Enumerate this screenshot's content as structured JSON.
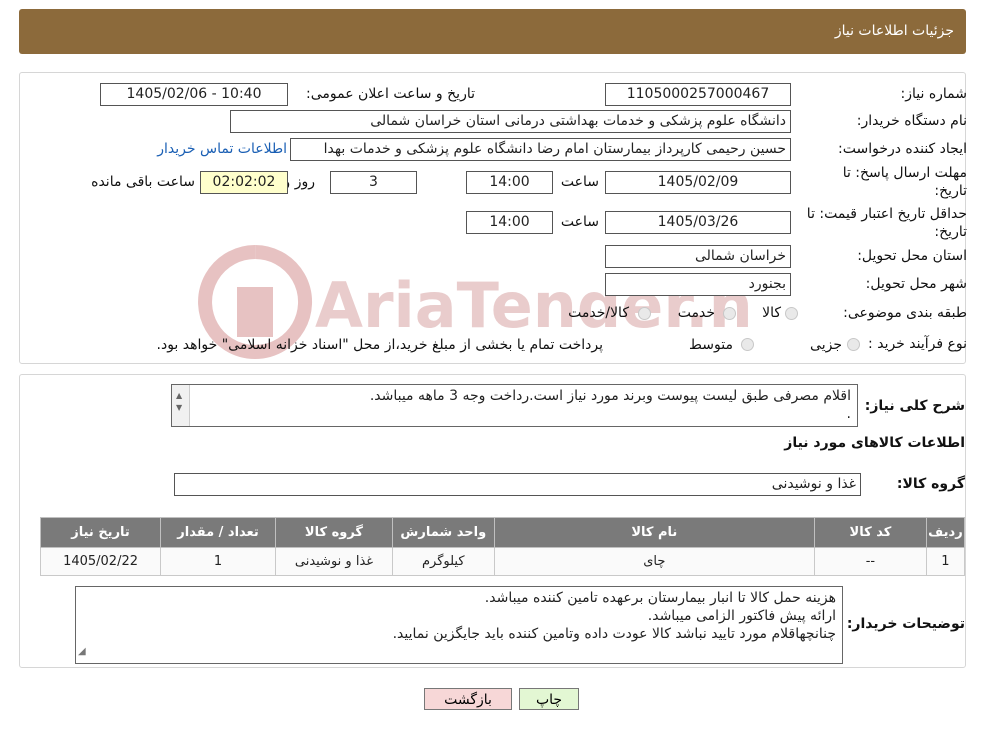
{
  "header": {
    "title": "جزئیات اطلاعات نیاز"
  },
  "fields": {
    "need_number_label": "شماره نیاز:",
    "need_number": "1105000257000467",
    "announce_label": "تاریخ و ساعت اعلان عمومی:",
    "announce_value": "1405/02/06 - 10:40",
    "buyer_label": "نام دستگاه خریدار:",
    "buyer_value": "دانشگاه علوم پزشکی و خدمات بهداشتی درمانی استان خراسان شمالی",
    "creator_label": "ایجاد کننده درخواست:",
    "creator_value": "حسین رحیمی کارپرداز بیمارستان امام رضا دانشگاه علوم پزشکی و خدمات بهدا",
    "contact_link": "اطلاعات تماس خریدار",
    "deadline_label_1": "مهلت ارسال پاسخ: تا",
    "deadline_label_2": "تاریخ:",
    "deadline_date": "1405/02/09",
    "time_label": "ساعت",
    "deadline_time": "14:00",
    "days_value": "3",
    "days_label": "روز و",
    "remaining_value": "02:02:02",
    "remaining_label": "ساعت باقی مانده",
    "validity_label_1": "حداقل تاریخ اعتبار قیمت: تا",
    "validity_label_2": "تاریخ:",
    "validity_date": "1405/03/26",
    "validity_time_label": "ساعت",
    "validity_time": "14:00",
    "province_label": "استان محل تحویل:",
    "province_value": "خراسان شمالی",
    "city_label": "شهر محل تحویل:",
    "city_value": "بجنورد",
    "category_label": "طبقه بندی موضوعی:",
    "category_options": [
      "کالا",
      "خدمت",
      "کالا/خدمت"
    ],
    "process_label": "نوع فرآیند خرید :",
    "process_options": [
      "جزیی",
      "متوسط"
    ],
    "process_note": "پرداخت تمام یا بخشی از مبلغ خرید،از محل \"اسناد خزانه اسلامی\" خواهد بود."
  },
  "summary": {
    "label": "شرح کلی نیاز:",
    "text_line1": "اقلام مصرفی طبق لیست پیوست وبرند مورد نیاز است.رداخت وجه 3 ماهه میباشد.",
    "text_line2": "."
  },
  "goods": {
    "section_title": "اطلاعات کالاهای مورد نیاز",
    "group_label": "گروه کالا:",
    "group_value": "غذا و نوشیدنی",
    "columns": [
      "ردیف",
      "کد کالا",
      "نام کالا",
      "واحد شمارش",
      "گروه کالا",
      "تعداد / مقدار",
      "تاریخ نیاز"
    ],
    "rows": [
      [
        "1",
        "--",
        "چای",
        "کیلوگرم",
        "غذا و نوشیدنی",
        "1",
        "1405/02/22"
      ]
    ]
  },
  "buyer_notes": {
    "label": "توضیحات خریدار:",
    "line1": "هزینه حمل کالا تا انبار بیمارستان برعهده تامین کننده میباشد.",
    "line2": "ارائه پیش فاکتور الزامی میباشد.",
    "line3": "چنانچهاقلام مورد تایید نباشد کالا عودت داده وتامین کننده باید جایگزین نمایید."
  },
  "buttons": {
    "back": "بازگشت",
    "print": "چاپ"
  },
  "watermark_text": "AriaTender.neT",
  "colors": {
    "header": "#8c6a3b",
    "table_header": "#7a7a7a",
    "timer_bg": "#ffffcc",
    "back_btn": "#f7d7d7",
    "print_btn": "#e3f7d3",
    "watermark": "#e2b1b1"
  }
}
